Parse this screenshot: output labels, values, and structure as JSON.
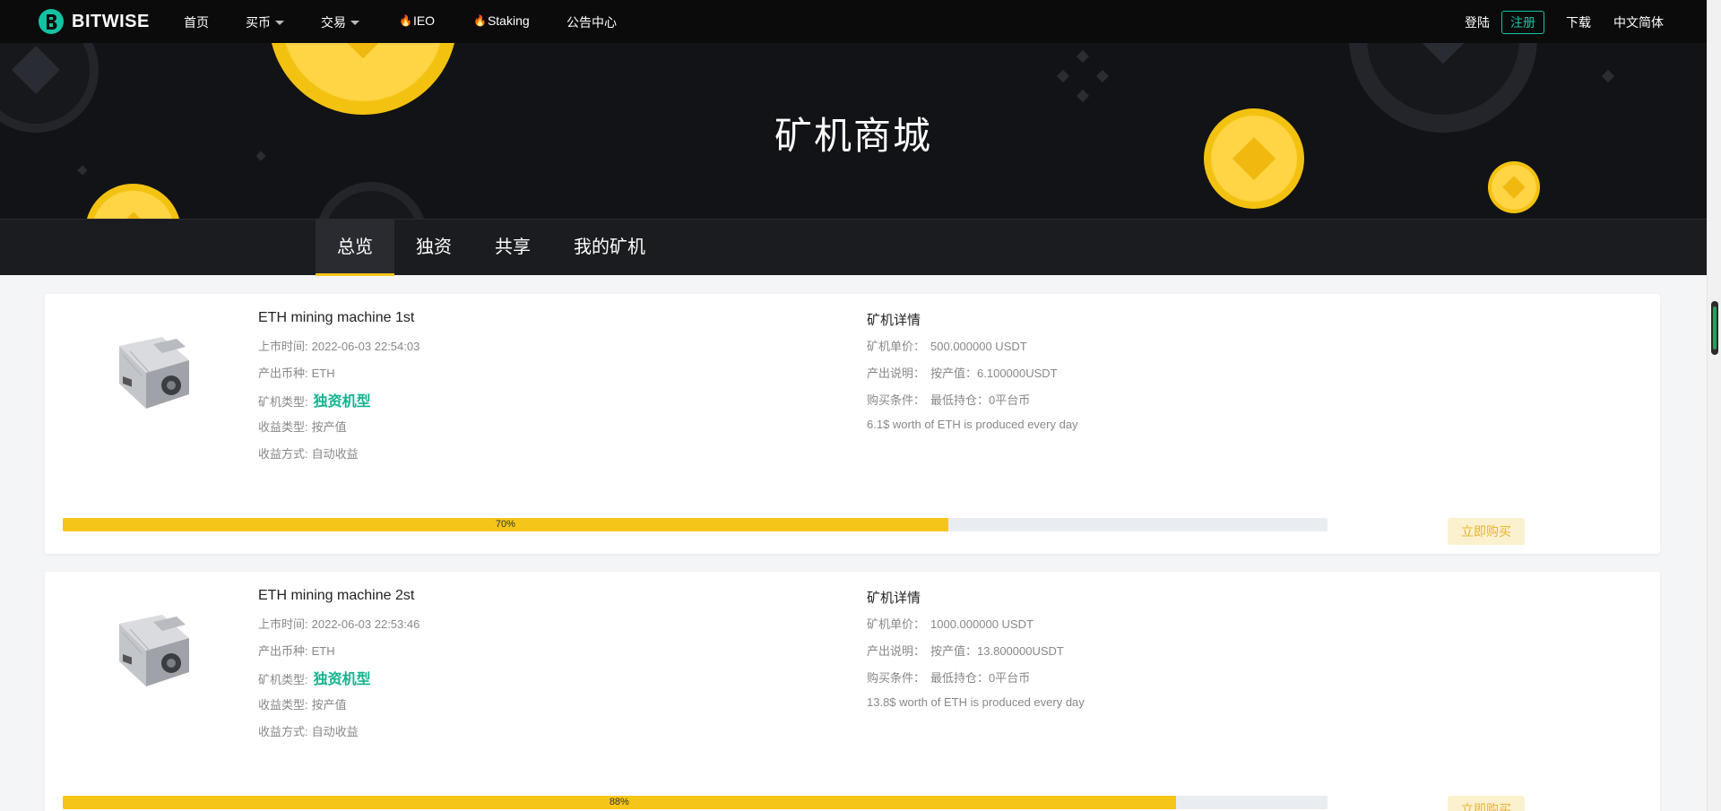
{
  "nav": {
    "brand": "BITWISE",
    "items": [
      "首页",
      "买币",
      "交易",
      "IEO",
      "Staking",
      "公告中心"
    ],
    "login": "登陆",
    "register": "注册",
    "download": "下载",
    "language": "中文简体"
  },
  "hero": {
    "title": "矿机商城"
  },
  "tabs": [
    "总览",
    "独资",
    "共享",
    "我的矿机"
  ],
  "labels": {
    "listed": "上市时间:",
    "coin": "产出币种:",
    "type": "矿机类型:",
    "income_type": "收益类型:",
    "income_mode": "收益方式:",
    "details": "矿机详情",
    "unit_price": "矿机单价：",
    "output_desc": "产出说明：",
    "condition": "购买条件：",
    "buy": "立即购买"
  },
  "machines": [
    {
      "name": "ETH mining machine 1st",
      "listed": "2022-06-03 22:54:03",
      "coin": "ETH",
      "type": "独资机型",
      "income_type": "按产值",
      "income_mode": "自动收益",
      "unit_price": "500.000000 USDT",
      "output_desc": "按产值：6.100000USDT",
      "condition": "最低持仓：0平台币",
      "note": "6.1$ worth of ETH is produced every day",
      "progress": 70,
      "progress_label": "70%"
    },
    {
      "name": "ETH mining machine 2st",
      "listed": "2022-06-03 22:53:46",
      "coin": "ETH",
      "type": "独资机型",
      "income_type": "按产值",
      "income_mode": "自动收益",
      "unit_price": "1000.000000 USDT",
      "output_desc": "按产值：13.800000USDT",
      "condition": "最低持仓：0平台币",
      "note": "13.8$ worth of ETH is produced every day",
      "progress": 88,
      "progress_label": "88%"
    }
  ],
  "colors": {
    "accent": "#f5c518",
    "green": "#13b38f",
    "register": "#13c2a3"
  }
}
